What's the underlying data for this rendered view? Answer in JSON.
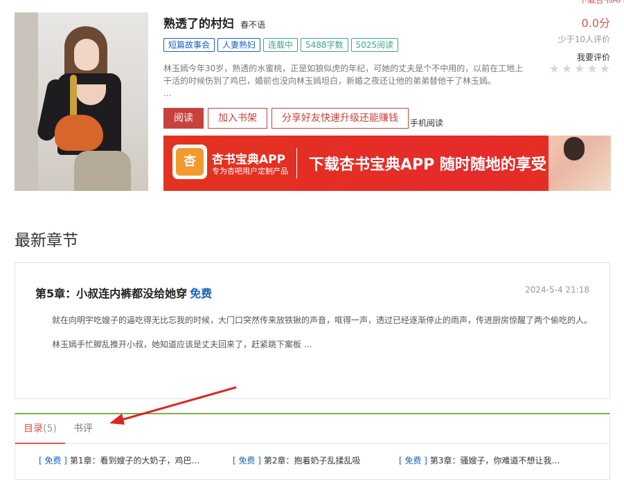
{
  "corner_text": "下载杏书APP",
  "book": {
    "title": "熟透了的村妇",
    "author": "春不语",
    "tags": [
      "短篇故事会",
      "人妻熟妇",
      "连载中",
      "5488字数",
      "5025阅读"
    ],
    "description": "林玉嫣今年30岁，熟透的水蜜桃，正是如狼似虎的年纪，可她的丈夫是个不中用的，以前在工地上干活的时候伤到了鸡巴，婚前也没向林玉嫣坦白，新婚之夜还让他的弟弟替他干了林玉嫣。",
    "ellipsis": "...",
    "cover_alt": "book-cover"
  },
  "actions": {
    "read": "阅读",
    "add_shelf": "加入书架",
    "share": "分享好友快速升级还能赚钱",
    "mobile": "手机阅读"
  },
  "rating": {
    "score": "0.0分",
    "count": "少于10人评价",
    "rate_label": "我要评价",
    "stars": 0
  },
  "banner": {
    "logo_char": "杏",
    "app_name": "杏书宝典APP",
    "app_sub": "专为杏吧用户定制产品",
    "slogan": "下载杏书宝典APP 随时随地的享受"
  },
  "latest": {
    "section_title": "最新章节",
    "chapter_title": "第5章：小叔连内裤都没给她穿",
    "free_label": "免费",
    "date": "2024-5-4 21:18",
    "paragraphs": [
      "就在向明宇吃嫂子的逼吃得无比忘我的时候，大门口突然传来放铁锹的声音，哐得一声，透过已经逐渐停止的雨声，传进厨房惊醒了两个偷吃的人。",
      "林玉嫣手忙脚乱推开小叔，她知道应该是丈夫回来了，赶紧跳下案板 ..."
    ]
  },
  "tabs": [
    {
      "label": "目录",
      "count": "(5)"
    },
    {
      "label": "书评",
      "count": ""
    }
  ],
  "chapters": [
    {
      "free": "[ 免费 ]",
      "title": "第1章：看到嫂子的大奶子，鸡巴翘..."
    },
    {
      "free": "[ 免费 ]",
      "title": "第2章：抱着奶子乱揉乱吸"
    },
    {
      "free": "[ 免费 ]",
      "title": "第3章：骚嫂子，你难道不想让我的..."
    }
  ],
  "colors": {
    "accent": "#c9413c",
    "tag_blue": "#1a62b5",
    "tag_green": "#3fa58a",
    "tab_border": "#7cb342",
    "annotation_arrow": "#e02424"
  }
}
